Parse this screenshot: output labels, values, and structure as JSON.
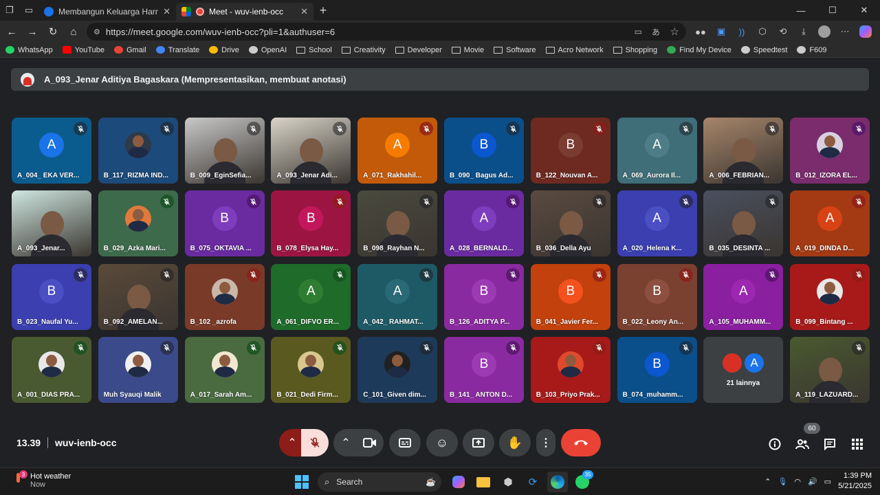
{
  "browser": {
    "tabs": [
      {
        "title": "Membangun Keluarga Harmonis M",
        "active": false
      },
      {
        "title": "Meet - wuv-ienb-occ",
        "active": true
      }
    ],
    "new_tab": "+",
    "url": "https://meet.google.com/wuv-ienb-occ?pli=1&authuser=6",
    "bookmarks": [
      {
        "label": "WhatsApp",
        "icon": "whatsapp-icon",
        "color": "#25d366"
      },
      {
        "label": "YouTube",
        "icon": "youtube-icon",
        "color": "#ff0000"
      },
      {
        "label": "Gmail",
        "icon": "gmail-icon",
        "color": "#ea4335"
      },
      {
        "label": "Translate",
        "icon": "translate-icon",
        "color": "#4285f4"
      },
      {
        "label": "Drive",
        "icon": "drive-icon",
        "color": "#fbbc04"
      },
      {
        "label": "OpenAI",
        "icon": "openai-icon",
        "color": "#cccccc"
      },
      {
        "label": "School",
        "icon": "folder-icon",
        "color": ""
      },
      {
        "label": "Creativity",
        "icon": "folder-icon",
        "color": ""
      },
      {
        "label": "Developer",
        "icon": "folder-icon",
        "color": ""
      },
      {
        "label": "Movie",
        "icon": "folder-icon",
        "color": ""
      },
      {
        "label": "Software",
        "icon": "folder-icon",
        "color": ""
      },
      {
        "label": "Acro Network",
        "icon": "folder-icon",
        "color": ""
      },
      {
        "label": "Shopping",
        "icon": "folder-icon",
        "color": ""
      },
      {
        "label": "Find My Device",
        "icon": "find-device-icon",
        "color": "#34a853"
      },
      {
        "label": "Speedtest",
        "icon": "speedtest-icon",
        "color": "#cccccc"
      },
      {
        "label": "F609",
        "icon": "globe-icon",
        "color": "#cccccc"
      }
    ]
  },
  "meet": {
    "presenter_banner": "A_093_Jenar Aditiya Bagaskara (Mempresentasikan, membuat anotasi)",
    "participants": [
      {
        "name": "A_004_ EKA VER...",
        "kind": "letter",
        "letter": "A",
        "bg": "#0b5c8e",
        "circle": "#1a73e8",
        "mic": "muted-dark"
      },
      {
        "name": "B_117_RIZMA IND...",
        "kind": "photo",
        "bg": "#1c4a7a",
        "circle": "#2d3a4a",
        "mic": "muted-dark"
      },
      {
        "name": "B_009_EginSefia...",
        "kind": "video",
        "bg": "#c8c8c8",
        "circle": "",
        "mic": "muted-dark"
      },
      {
        "name": "A_093_Jenar Adi...",
        "kind": "video",
        "bg": "#d9d4c8",
        "circle": "",
        "mic": "muted-dark"
      },
      {
        "name": "A_071_Rakhahil...",
        "kind": "letter",
        "letter": "A",
        "bg": "#c35a0a",
        "circle": "#f57c00",
        "mic": "muted-red"
      },
      {
        "name": "B_090_ Bagus Ad...",
        "kind": "letter",
        "letter": "B",
        "bg": "#0a4f8a",
        "circle": "#0b57d0",
        "mic": "muted-dark"
      },
      {
        "name": "B_122_Nouvan A...",
        "kind": "letter",
        "letter": "B",
        "bg": "#6e2a20",
        "circle": "#7a3b31",
        "mic": "muted-red"
      },
      {
        "name": "A_069_Aurora Il...",
        "kind": "letter",
        "letter": "A",
        "bg": "#3f6e78",
        "circle": "#4f7d87",
        "mic": "muted-dark"
      },
      {
        "name": "A_006_FEBRIAN...",
        "kind": "video",
        "bg": "#a7866b",
        "circle": "",
        "mic": "muted-dark"
      },
      {
        "name": "B_012_IZORA EL...",
        "kind": "photo",
        "bg": "#7a2c6d",
        "circle": "#d8d0e0",
        "mic": "muted-purple"
      },
      {
        "name": "A_093_Jenar...",
        "kind": "video",
        "bg": "#cfe6e0",
        "circle": "",
        "mic": "none"
      },
      {
        "name": "B_029_Azka Mari...",
        "kind": "photo",
        "bg": "#3e6a4c",
        "circle": "#e07a3c",
        "mic": "muted-green"
      },
      {
        "name": "B_075_OKTAVIA ...",
        "kind": "letter",
        "letter": "B",
        "bg": "#6a2ba0",
        "circle": "#7e3dbd",
        "mic": "muted-purple"
      },
      {
        "name": "B_078_Elysa Hay...",
        "kind": "letter",
        "letter": "B",
        "bg": "#9c1542",
        "circle": "#c2185b",
        "mic": "muted-red"
      },
      {
        "name": "B_098_Rayhan N...",
        "kind": "video",
        "bg": "#4a4a3e",
        "circle": "",
        "mic": "muted-dark"
      },
      {
        "name": "A_028_BERNALD...",
        "kind": "letter",
        "letter": "A",
        "bg": "#6a2ba0",
        "circle": "#7e3dbd",
        "mic": "muted-purple"
      },
      {
        "name": "B_036_Della Ayu",
        "kind": "video",
        "bg": "#5a4a40",
        "circle": "",
        "mic": "muted-dark"
      },
      {
        "name": "A_020_Helena K...",
        "kind": "letter",
        "letter": "A",
        "bg": "#3b3fb0",
        "circle": "#4a4fc4",
        "mic": "muted-dark"
      },
      {
        "name": "B_035_DESINTA ...",
        "kind": "video",
        "bg": "#4a5060",
        "circle": "",
        "mic": "muted-dark"
      },
      {
        "name": "A_019_DINDA D...",
        "kind": "letter",
        "letter": "A",
        "bg": "#a33a14",
        "circle": "#d84315",
        "mic": "muted-red"
      },
      {
        "name": "B_023_Naufal Yu...",
        "kind": "letter",
        "letter": "B",
        "bg": "#3b3fb0",
        "circle": "#4a4fc4",
        "mic": "muted-dark"
      },
      {
        "name": "B_092_AMELAN...",
        "kind": "video",
        "bg": "#5a4a3a",
        "circle": "",
        "mic": "muted-dark"
      },
      {
        "name": "B_102 _azrofa",
        "kind": "photo",
        "bg": "#7a3a28",
        "circle": "#c9b8a8",
        "mic": "muted-red"
      },
      {
        "name": "A_061_DIFVO ER...",
        "kind": "letter",
        "letter": "A",
        "bg": "#1e6b2a",
        "circle": "#2e7d32",
        "mic": "muted-green"
      },
      {
        "name": "A_042_ RAHMAT...",
        "kind": "letter",
        "letter": "A",
        "bg": "#1e5a66",
        "circle": "#2a6a76",
        "mic": "muted-dark"
      },
      {
        "name": "B_126_ADITYA P...",
        "kind": "letter",
        "letter": "B",
        "bg": "#8a2aa0",
        "circle": "#9c3ab4",
        "mic": "muted-purple"
      },
      {
        "name": "B_041_Javier Fer...",
        "kind": "letter",
        "letter": "B",
        "bg": "#c2410c",
        "circle": "#f4511e",
        "mic": "muted-red"
      },
      {
        "name": "B_022_Leony An...",
        "kind": "letter",
        "letter": "B",
        "bg": "#7a4030",
        "circle": "#8d5040",
        "mic": "muted-red"
      },
      {
        "name": "A_105_MUHAMM...",
        "kind": "letter",
        "letter": "A",
        "bg": "#8a1fa0",
        "circle": "#9c27b0",
        "mic": "muted-purple"
      },
      {
        "name": "B_099_Bintang ...",
        "kind": "photo",
        "bg": "#a81a1a",
        "circle": "#e8e8e8",
        "mic": "muted-red"
      },
      {
        "name": "A_001_DIAS PRA...",
        "kind": "photo",
        "bg": "#4a5a30",
        "circle": "#e8e8e8",
        "mic": "muted-green"
      },
      {
        "name": "Muh Syauqi Malik",
        "kind": "photo",
        "bg": "#3a4a8a",
        "circle": "#f0f0f0",
        "mic": "muted-dark"
      },
      {
        "name": "A_017_Sarah Am...",
        "kind": "photo",
        "bg": "#4a6a40",
        "circle": "#f0e8d0",
        "mic": "muted-green"
      },
      {
        "name": "B_021_Dedi Firm...",
        "kind": "photo",
        "bg": "#5a5a20",
        "circle": "#d8c890",
        "mic": "muted-green"
      },
      {
        "name": "C_101_Given dim...",
        "kind": "photo",
        "bg": "#1e3a5a",
        "circle": "#202020",
        "mic": "muted-dark"
      },
      {
        "name": "B_141_ ANTON D...",
        "kind": "letter",
        "letter": "B",
        "bg": "#8a2aa0",
        "circle": "#9c3ab4",
        "mic": "muted-purple"
      },
      {
        "name": "B_103_Priyo Prak...",
        "kind": "photo",
        "bg": "#a81a1a",
        "circle": "#e04a2a",
        "mic": "muted-red"
      },
      {
        "name": "B_074_muhamm...",
        "kind": "letter",
        "letter": "B",
        "bg": "#0a4f8a",
        "circle": "#0b57d0",
        "mic": "muted-dark"
      },
      {
        "name": "A_119_LAZUARD...",
        "kind": "video",
        "bg": "#4a5a30",
        "circle": "",
        "mic": "muted-dark"
      }
    ],
    "more_tile": {
      "label": "21 lainnya",
      "letter": "A"
    },
    "time": "13.39",
    "meeting_code": "wuv-ienb-occ",
    "people_count": "60"
  },
  "taskbar": {
    "weather_title": "Hot weather",
    "weather_sub": "Now",
    "weather_badge": "3",
    "search_label": "Search",
    "whatsapp_badge": "35",
    "time": "1:39 PM",
    "date": "5/21/2025"
  }
}
